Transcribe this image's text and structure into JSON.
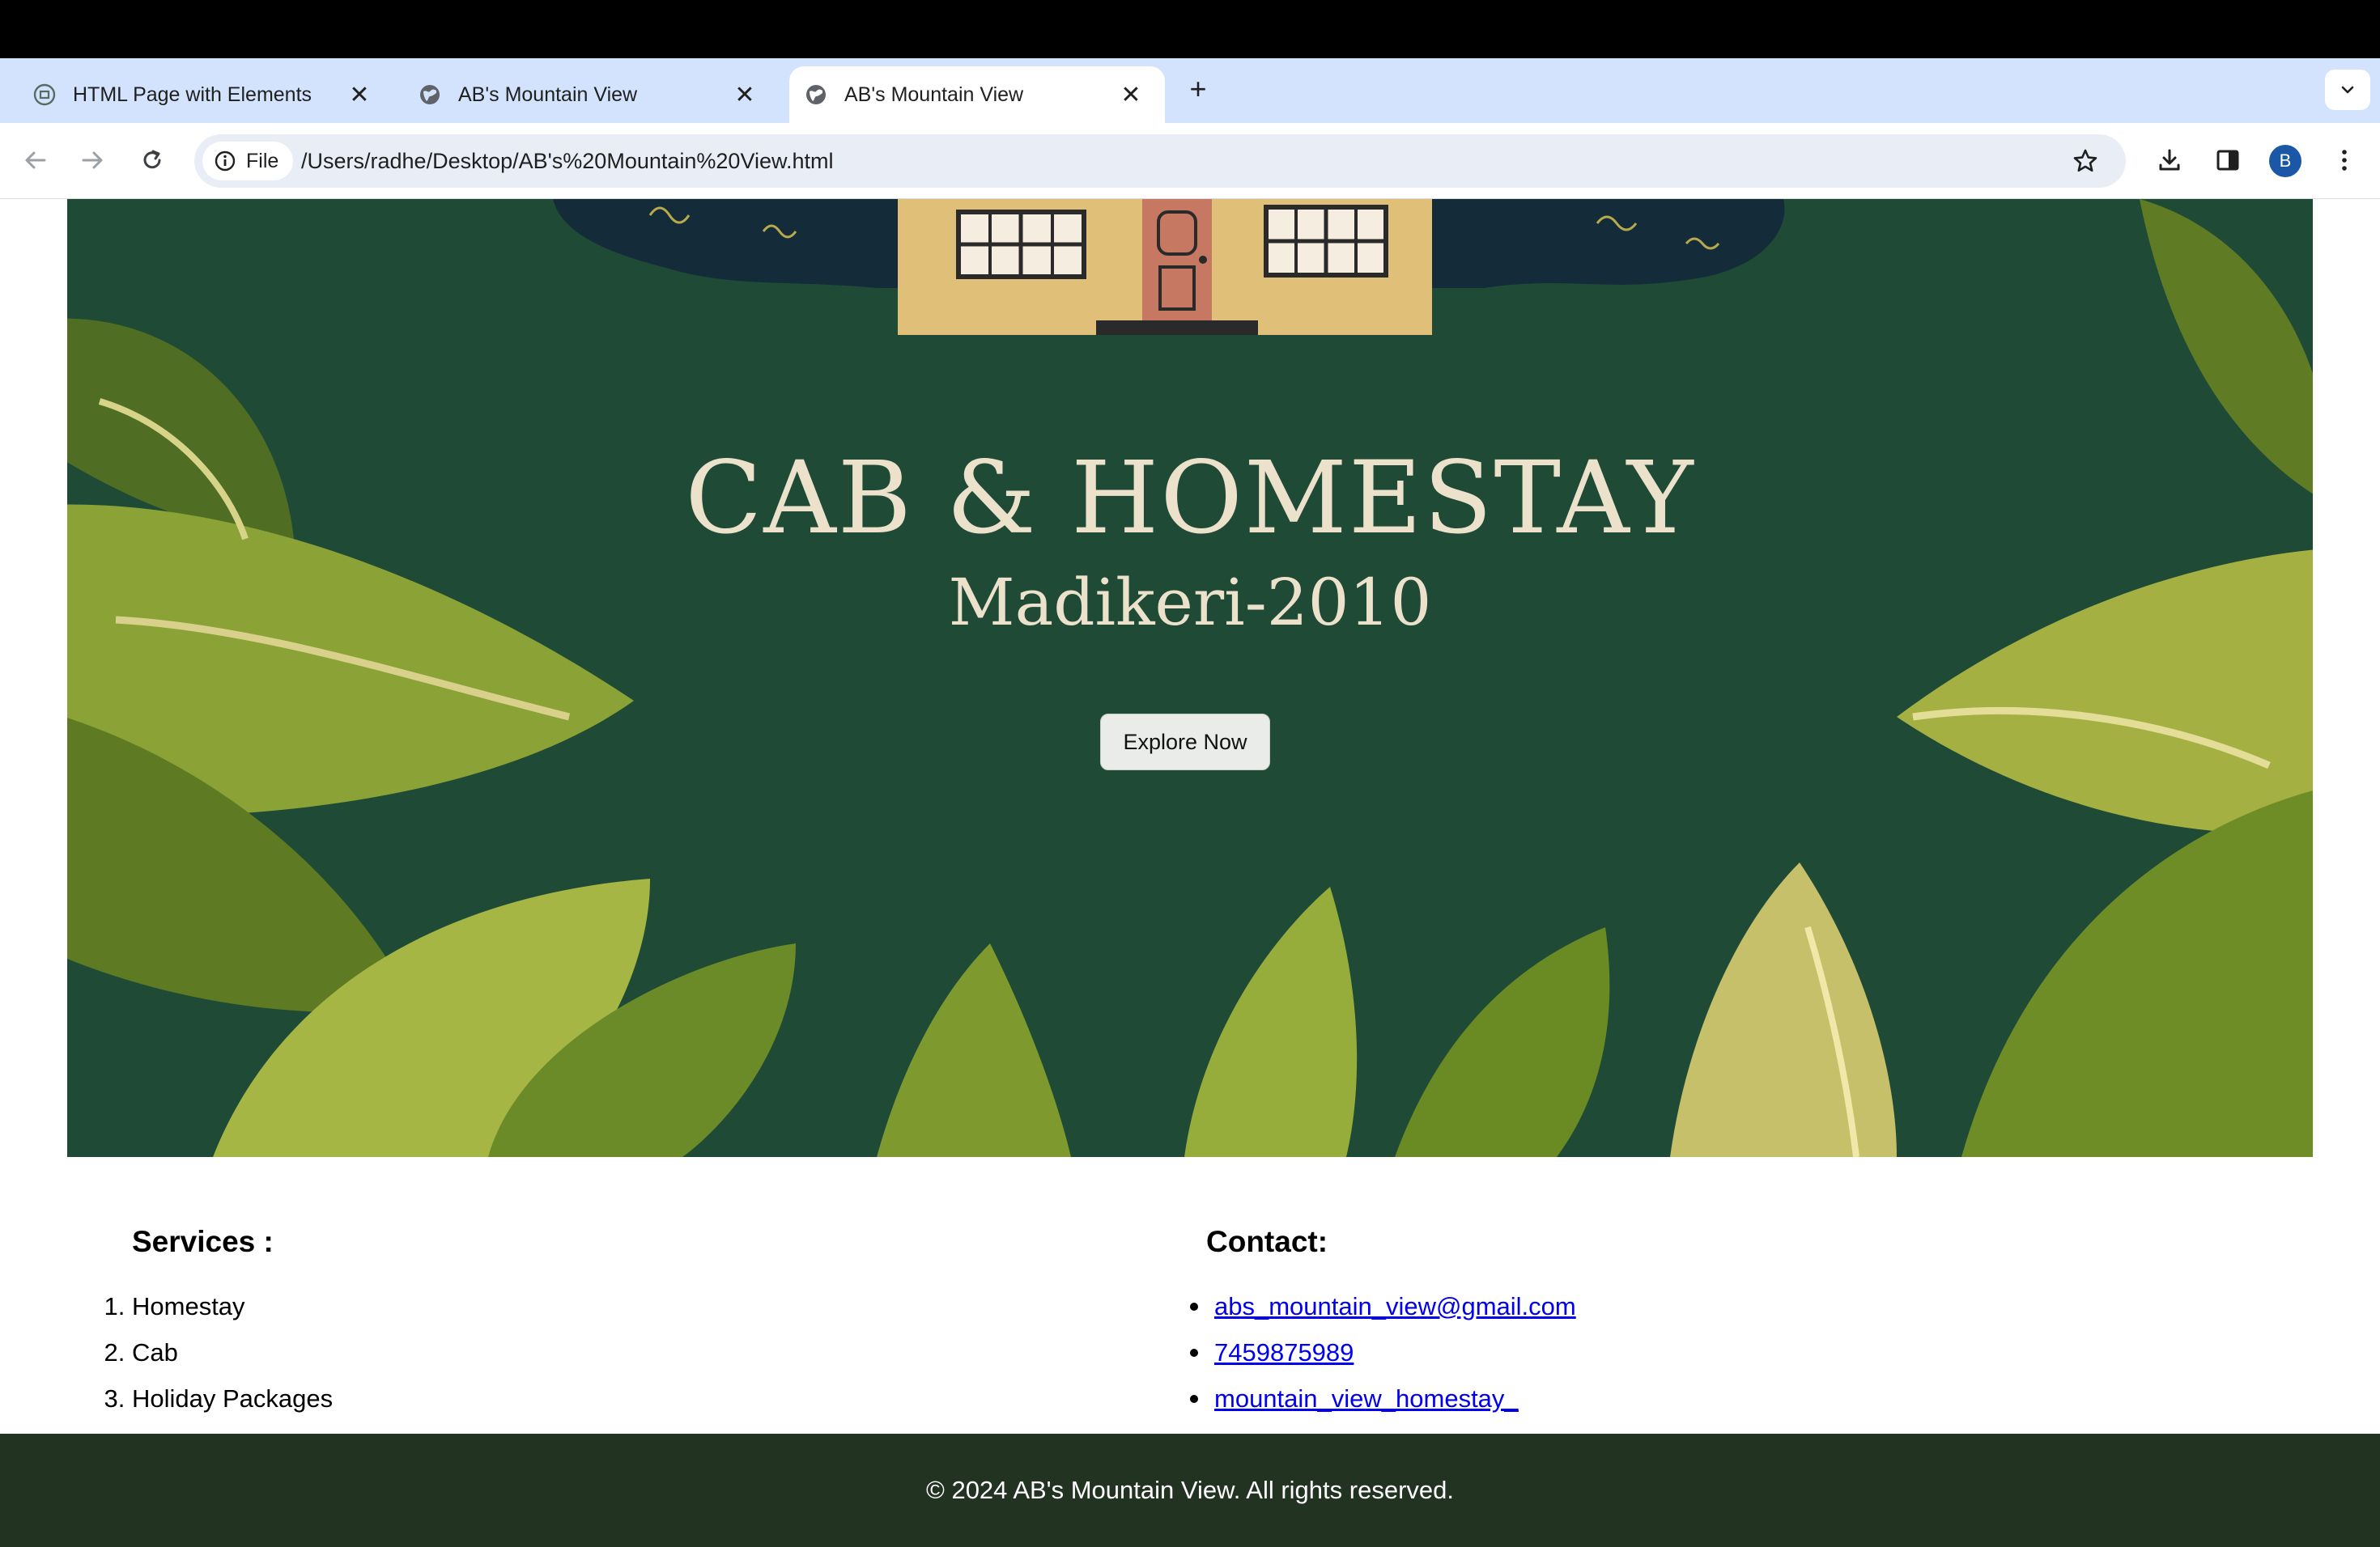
{
  "browser": {
    "tabs": [
      {
        "title": "HTML Page with Elements",
        "icon": "chatgpt-icon",
        "active": false
      },
      {
        "title": "AB's Mountain View",
        "icon": "globe-icon",
        "active": false
      },
      {
        "title": "AB's Mountain View",
        "icon": "globe-icon",
        "active": true
      }
    ],
    "new_tab_symbol": "+",
    "close_symbol": "✕",
    "scheme_chip": "File",
    "url": "/Users/radhe/Desktop/AB's%20Mountain%20View.html",
    "profile_initial": "B",
    "accent_color": "#d3e3fd"
  },
  "hero": {
    "title": "CAB & HOMESTAY",
    "subtitle": "Madikeri-2010",
    "cta_label": "Explore Now",
    "background_color": "#1e4a35"
  },
  "services": {
    "heading": "Services :",
    "items": [
      "Homestay",
      "Cab",
      "Holiday Packages"
    ]
  },
  "contact": {
    "heading": "Contact:",
    "items": [
      "abs_mountain_view@gmail.com",
      "7459875989",
      "mountain_view_homestay_"
    ],
    "link_color": "#0000ee"
  },
  "footer": {
    "text": "© 2024 AB's Mountain View. All rights reserved.",
    "background_color": "#223322"
  }
}
